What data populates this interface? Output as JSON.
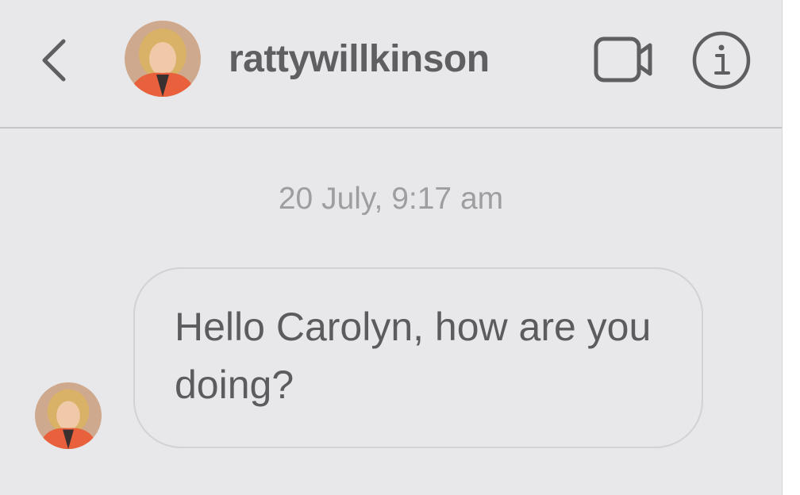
{
  "header": {
    "username": "rattywillkinson"
  },
  "conversation": {
    "timestamp": "20 July, 9:17 am",
    "messages": [
      {
        "text": "Hello Carolyn, how are you doing?"
      }
    ]
  },
  "icons": {
    "back": "chevron-left-icon",
    "video": "video-camera-icon",
    "info": "info-icon"
  },
  "colors": {
    "background": "#e8e8ea",
    "text_primary": "#5f5f62",
    "text_muted": "#9e9ea2",
    "bubble_border": "#d2d2d5",
    "avatar_accent": "#e8613c"
  }
}
